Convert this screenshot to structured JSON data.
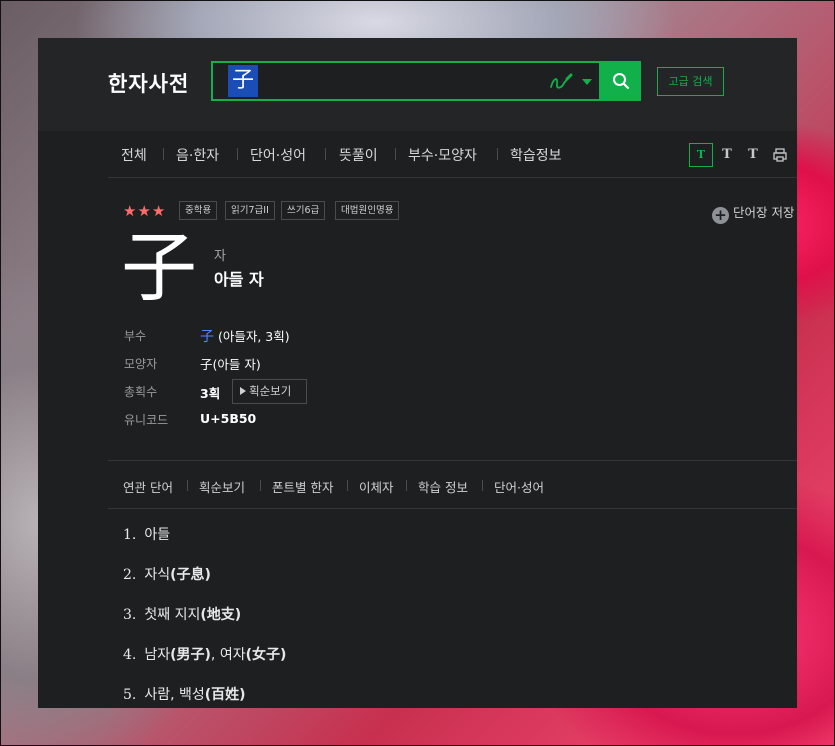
{
  "app": {
    "title": "한자사전"
  },
  "search": {
    "value": "子",
    "advanced_label": "고급 검색"
  },
  "tabs": [
    {
      "label": "전체"
    },
    {
      "label": "음·한자"
    },
    {
      "label": "단어·성어"
    },
    {
      "label": "뜻풀이"
    },
    {
      "label": "부수·모양자"
    },
    {
      "label": "학습정보"
    }
  ],
  "font_size_buttons": [
    "T",
    "T",
    "T"
  ],
  "entry": {
    "stars": "★★★",
    "badges": [
      "중학용",
      "읽기7급II",
      "쓰기6급",
      "대법원인명용"
    ],
    "save_label": "단어장 저장",
    "character": "子",
    "reading": "자",
    "meaning": "아들 자",
    "info": {
      "radical_label": "부수",
      "radical_char": "子",
      "radical_detail": " (아들자, 3획)",
      "shape_label": "모양자",
      "shape_value": "子(아들 자)",
      "strokes_label": "총획수",
      "strokes_value": "3획",
      "stroke_order_label": "획순보기",
      "unicode_label": "유니코드",
      "unicode_value": "U+5B50"
    }
  },
  "subnav": [
    {
      "label": "연관 단어"
    },
    {
      "label": "획순보기"
    },
    {
      "label": "폰트별 한자"
    },
    {
      "label": "이체자"
    },
    {
      "label": "학습 정보"
    },
    {
      "label": "단어·성어"
    }
  ],
  "definitions": [
    {
      "num": "1.",
      "text": "아들",
      "hanja": ""
    },
    {
      "num": "2.",
      "text": "자식",
      "hanja": "(子息)"
    },
    {
      "num": "3.",
      "text": "첫째 지지",
      "hanja": "(地支)"
    },
    {
      "num": "4.",
      "text": "남자",
      "hanja": "(男子)",
      "text2": ", 여자",
      "hanja2": "(女子)"
    },
    {
      "num": "5.",
      "text": "사람, 백성",
      "hanja": "(百姓)"
    }
  ],
  "colors": {
    "accent": "#11b04a",
    "highlight": "#1a4db5",
    "link": "#4a8cff",
    "stars": "#ff6b6b"
  }
}
